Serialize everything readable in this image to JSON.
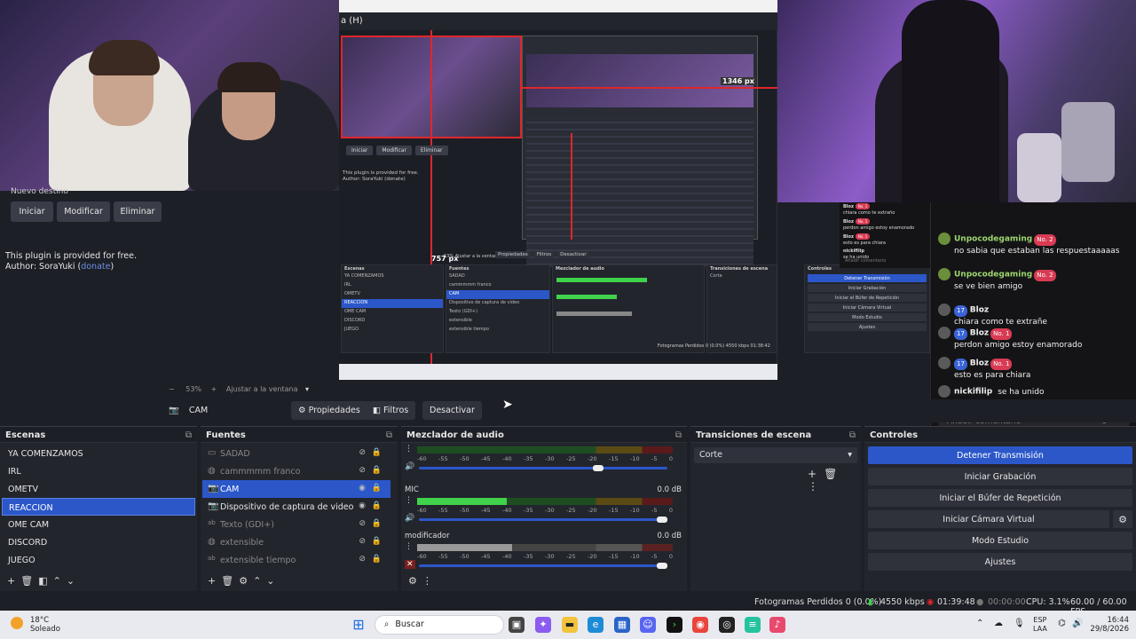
{
  "nested_window": {
    "title_fragment": "a (H)",
    "plugin_buttons": [
      "Iniciar",
      "Modificar",
      "Eliminar"
    ],
    "plugin_text_1": "This plugin is provided for free.",
    "plugin_text_2": "Author: SoraYuki (donate)",
    "size_label_1": "1346 px",
    "size_label_2": "757 px",
    "mini_scenes_header": "Escenas",
    "mini_scenes": [
      "YA COMENZAMOS",
      "IRL",
      "OMETV",
      "REACCION",
      "OME CAM",
      "DISCORD",
      "JUEGO"
    ],
    "mini_sources_header": "Fuentes",
    "mini_sources": [
      "SADAD",
      "cammmmm franco",
      "CAM",
      "Dispositivo de captura de video",
      "Texto (GDI+)",
      "extensible",
      "extensible tiempo"
    ],
    "mini_mixer_header": "Mezclador de audio",
    "mini_transitions_header": "Transiciones de escena",
    "mini_transition_value": "Corte",
    "mini_controls_header": "Controles",
    "mini_controls": [
      "Detener Transmisión",
      "Iniciar Grabación",
      "Iniciar el Búfer de Repetición",
      "Iniciar Cámara Virtual",
      "Modo Estudio",
      "Ajustes"
    ],
    "mini_props": [
      "Propiedades",
      "Filtros",
      "Desactivar"
    ],
    "mini_zoom": "53%  Ajustar a la ventana",
    "mini_status": "Fotogramas Perdidos 0 (0.0%)  4550 kbps  01:38:42"
  },
  "left_panel": {
    "partial_label": "Nuevo destino",
    "buttons": {
      "start": "Iniciar",
      "edit": "Modificar",
      "delete": "Eliminar"
    },
    "plugin_line1": "This plugin is provided for free.",
    "plugin_author": "Author: SoraYuki (",
    "plugin_link": "donate",
    "plugin_close": ")"
  },
  "chat": {
    "mini_messages": [
      {
        "user": "Bloz",
        "badge": "No. 1",
        "text": "chiara como te extraño"
      },
      {
        "user": "Bloz",
        "badge": "No. 1",
        "text": "perdon amigo estoy enamorado"
      },
      {
        "user": "Bloz",
        "badge": "No. 1",
        "text": "esto es para chiara"
      },
      {
        "user": "nickifilip",
        "badge": "",
        "text": "se ha unido"
      }
    ],
    "mini_input": "Añadir comentario",
    "messages": [
      {
        "user": "Unpocodegaming",
        "level": "",
        "badge": "No. 2",
        "text": "no sabia que estaban las respuestaaaaas"
      },
      {
        "user": "Unpocodegaming",
        "level": "",
        "badge": "No. 2",
        "text": "se ve bien amigo"
      },
      {
        "user": "Bloz",
        "level": "17",
        "badge": "",
        "text": "chiara como te extrañe"
      },
      {
        "user": "Bloz",
        "level": "17",
        "badge": "No. 1",
        "text": "perdon amigo estoy enamorado"
      },
      {
        "user": "Bloz",
        "level": "17",
        "badge": "No. 1",
        "text": "esto es para chiara"
      },
      {
        "user": "nickifilip",
        "level": "",
        "badge": "",
        "text": "se ha unido"
      }
    ],
    "input_placeholder": "Añadir comentario"
  },
  "preview": {
    "zoom": "53%",
    "fit_label": "Ajustar a la ventana"
  },
  "source_toolbar": {
    "selected_source": "CAM",
    "properties": "Propiedades",
    "filters": "Filtros",
    "deactivate": "Desactivar"
  },
  "scenes": {
    "header": "Escenas",
    "items": [
      "YA COMENZAMOS",
      "IRL",
      "OMETV",
      "REACCION",
      "OME CAM",
      "DISCORD",
      "JUEGO"
    ],
    "selected_index": 3
  },
  "sources": {
    "header": "Fuentes",
    "items": [
      {
        "name": "SADAD",
        "icon": "folder-icon",
        "visible": false
      },
      {
        "name": "cammmmm franco",
        "icon": "browser-icon",
        "visible": false
      },
      {
        "name": "CAM",
        "icon": "camera-icon",
        "visible": true
      },
      {
        "name": "Dispositivo de captura de video",
        "icon": "camera-icon",
        "visible": true
      },
      {
        "name": "Texto (GDI+)",
        "icon": "text-icon",
        "visible": false
      },
      {
        "name": "extensible",
        "icon": "browser-icon",
        "visible": false
      },
      {
        "name": "extensible tiempo",
        "icon": "text-icon",
        "visible": false
      }
    ]
  },
  "mixer": {
    "header": "Mezclador de audio",
    "scale": [
      "-60",
      "-55",
      "-50",
      "-45",
      "-40",
      "-35",
      "-30",
      "-25",
      "-20",
      "-15",
      "-10",
      "-5",
      "0"
    ],
    "channels": [
      {
        "name": "",
        "db": "",
        "level": 0.0,
        "volume": 0.73
      },
      {
        "name": "MIC",
        "db": "0.0 dB",
        "level": 0.35,
        "volume": 1.0
      },
      {
        "name": "modificador",
        "db": "0.0 dB",
        "level": 0.37,
        "volume": 1.0
      }
    ]
  },
  "transitions": {
    "header": "Transiciones de escena",
    "value": "Corte"
  },
  "controls": {
    "header": "Controles",
    "stop_stream": "Detener Transmisión",
    "start_recording": "Iniciar Grabación",
    "start_replay": "Iniciar el Búfer de Repetición",
    "start_virtual_cam": "Iniciar Cámara Virtual",
    "studio_mode": "Modo Estudio",
    "settings": "Ajustes"
  },
  "status": {
    "dropped_frames": "Fotogramas Perdidos 0 (0.0%)",
    "bitrate": "4550 kbps",
    "stream_time": "01:39:48",
    "record_time": "00:00:00",
    "cpu": "CPU: 3.1%",
    "fps": "60.00 / 60.00 FPS"
  },
  "taskbar": {
    "weather_temp": "18°C",
    "weather_desc": "Soleado",
    "search_placeholder": "Buscar",
    "lang": "ESP",
    "lang_sub": "LAA",
    "time": "16:44",
    "date": "29/8/2026"
  },
  "colors": {
    "accent": "#2b57c9",
    "panel": "#23252d",
    "background": "#1d1f26",
    "recording_red": "#e0262b"
  }
}
